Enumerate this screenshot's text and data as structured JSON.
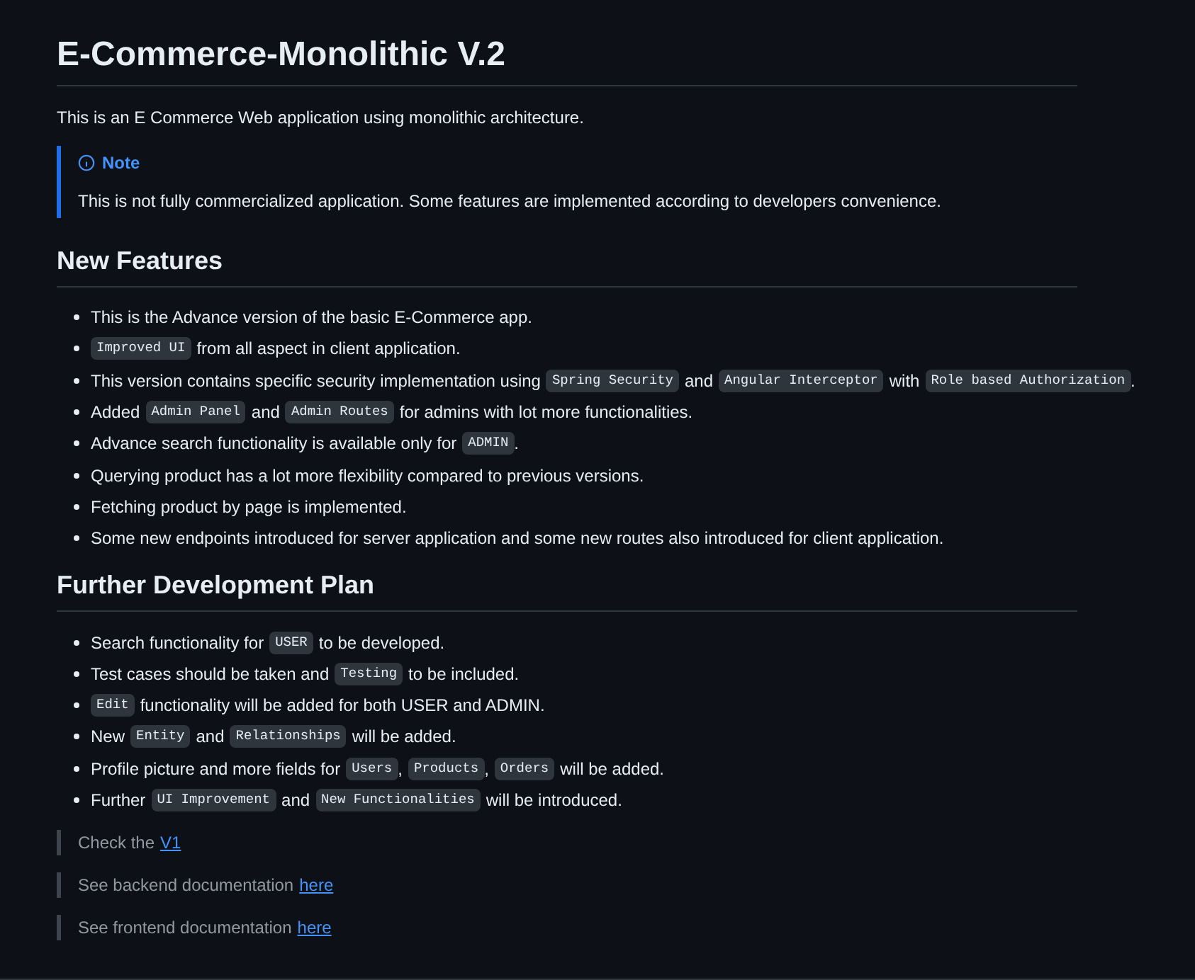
{
  "title": "E-Commerce-Monolithic V.2",
  "intro": "This is an E Commerce Web application using monolithic architecture.",
  "note": {
    "label": "Note",
    "text": "This is not fully commercialized application. Some features are implemented according to developers convenience."
  },
  "sections": [
    {
      "heading": "New Features",
      "items": [
        [
          {
            "kind": "text",
            "text": "This is the Advance version of the basic E-Commerce app."
          }
        ],
        [
          {
            "kind": "code",
            "text": "Improved UI"
          },
          {
            "kind": "text",
            "text": "from all aspect in client application."
          }
        ],
        [
          {
            "kind": "text",
            "text": "This version contains specific security implementation using"
          },
          {
            "kind": "code",
            "text": "Spring Security"
          },
          {
            "kind": "text",
            "text": "and"
          },
          {
            "kind": "code",
            "text": "Angular Interceptor"
          },
          {
            "kind": "text",
            "text": "with"
          },
          {
            "kind": "code",
            "text": "Role based Authorization"
          },
          {
            "kind": "text",
            "text": "."
          }
        ],
        [
          {
            "kind": "text",
            "text": "Added"
          },
          {
            "kind": "code",
            "text": "Admin Panel"
          },
          {
            "kind": "text",
            "text": "and"
          },
          {
            "kind": "code",
            "text": "Admin Routes"
          },
          {
            "kind": "text",
            "text": "for admins with lot more functionalities."
          }
        ],
        [
          {
            "kind": "text",
            "text": "Advance search functionality is available only for"
          },
          {
            "kind": "code",
            "text": "ADMIN"
          },
          {
            "kind": "text",
            "text": "."
          }
        ],
        [
          {
            "kind": "text",
            "text": "Querying product has a lot more flexibility compared to previous versions."
          }
        ],
        [
          {
            "kind": "text",
            "text": "Fetching product by page is implemented."
          }
        ],
        [
          {
            "kind": "text",
            "text": "Some new endpoints introduced for server application and some new routes also introduced for client application."
          }
        ]
      ]
    },
    {
      "heading": "Further Development Plan",
      "items": [
        [
          {
            "kind": "text",
            "text": "Search functionality for"
          },
          {
            "kind": "code",
            "text": "USER"
          },
          {
            "kind": "text",
            "text": "to be developed."
          }
        ],
        [
          {
            "kind": "text",
            "text": "Test cases should be taken and"
          },
          {
            "kind": "code",
            "text": "Testing"
          },
          {
            "kind": "text",
            "text": "to be included."
          }
        ],
        [
          {
            "kind": "code",
            "text": "Edit"
          },
          {
            "kind": "text",
            "text": "functionality will be added for both USER and ADMIN."
          }
        ],
        [
          {
            "kind": "text",
            "text": "New"
          },
          {
            "kind": "code",
            "text": "Entity"
          },
          {
            "kind": "text",
            "text": "and"
          },
          {
            "kind": "code",
            "text": "Relationships"
          },
          {
            "kind": "text",
            "text": "will be added."
          }
        ],
        [
          {
            "kind": "text",
            "text": "Profile picture and more fields for"
          },
          {
            "kind": "code",
            "text": "Users"
          },
          {
            "kind": "text",
            "text": ","
          },
          {
            "kind": "code",
            "text": "Products"
          },
          {
            "kind": "text",
            "text": ","
          },
          {
            "kind": "code",
            "text": "Orders"
          },
          {
            "kind": "text",
            "text": "will be added."
          }
        ],
        [
          {
            "kind": "text",
            "text": "Further"
          },
          {
            "kind": "code",
            "text": "UI Improvement"
          },
          {
            "kind": "text",
            "text": "and"
          },
          {
            "kind": "code",
            "text": "New Functionalities"
          },
          {
            "kind": "text",
            "text": "will be introduced."
          }
        ]
      ]
    }
  ],
  "quotes": [
    {
      "text": "Check the",
      "link": "V1"
    },
    {
      "text": "See backend documentation",
      "link": "here"
    },
    {
      "text": "See frontend documentation",
      "link": "here"
    }
  ]
}
